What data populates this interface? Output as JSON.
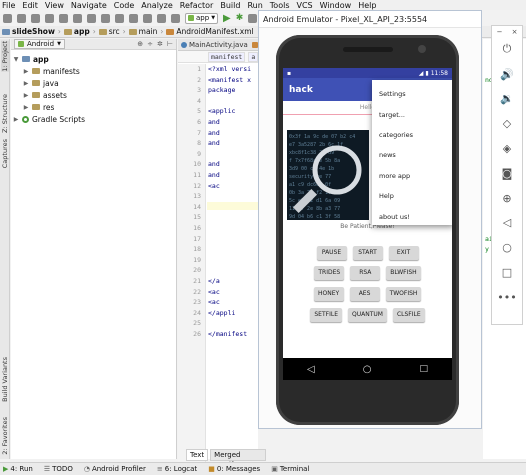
{
  "menubar": [
    "File",
    "Edit",
    "View",
    "Navigate",
    "Code",
    "Analyze",
    "Refactor",
    "Build",
    "Run",
    "Tools",
    "VCS",
    "Window",
    "Help"
  ],
  "toolbar": {
    "run_config": "app"
  },
  "breadcrumbs": [
    "slideShow",
    "app",
    "src",
    "main",
    "AndroidManifest.xml"
  ],
  "left_strip": {
    "project": "1: Project",
    "structure": "Z: Structure",
    "captures": "Captures",
    "build_variants": "Build Variants",
    "favorites": "2: Favorites"
  },
  "project_panel": {
    "view_mode": "Android",
    "tree": [
      {
        "label": "app",
        "depth": 0,
        "icon": "folder-icon",
        "expanded": true
      },
      {
        "label": "manifests",
        "depth": 1,
        "icon": "folder-icon"
      },
      {
        "label": "java",
        "depth": 1,
        "icon": "folder-icon"
      },
      {
        "label": "assets",
        "depth": 1,
        "icon": "folder-icon"
      },
      {
        "label": "res",
        "depth": 1,
        "icon": "folder-icon"
      },
      {
        "label": "Gradle Scripts",
        "depth": 0,
        "icon": "gradle-icon"
      }
    ]
  },
  "editor": {
    "tabs": [
      "MainActivity.java",
      "a"
    ],
    "breadcrumb": [
      "manifest",
      "a"
    ],
    "line_numbers": [
      "1",
      "2",
      "3",
      "4",
      "5",
      "6",
      "7",
      "8",
      "9",
      "10",
      "11",
      "12",
      "13",
      "14",
      "15",
      "16",
      "17",
      "18",
      "19",
      "20",
      "21",
      "22",
      "23",
      "24",
      "25",
      "26"
    ],
    "code_lines": [
      {
        "n": 1,
        "text": "<?xml versi"
      },
      {
        "n": 2,
        "text": "<manifest x"
      },
      {
        "n": 3,
        "text": "    package"
      },
      {
        "n": 5,
        "text": "  <applic"
      },
      {
        "n": 6,
        "text": "      and"
      },
      {
        "n": 7,
        "text": "      and"
      },
      {
        "n": 8,
        "text": "      and"
      },
      {
        "n": 10,
        "text": "      and"
      },
      {
        "n": 11,
        "text": "      and"
      },
      {
        "n": 12,
        "text": "      <ac"
      },
      {
        "n": 21,
        "text": "      </a"
      },
      {
        "n": 22,
        "text": "      <ac"
      },
      {
        "n": 23,
        "text": "      <ac"
      },
      {
        "n": 24,
        "text": "  </appli"
      },
      {
        "n": 26,
        "text": "</manifest"
      }
    ],
    "right_fragments": [
      {
        "line": 2,
        "text": "ndr"
      },
      {
        "line": 17,
        "text": "ain"
      },
      {
        "line": 18,
        "text": "y"
      }
    ]
  },
  "bottom_tabs": [
    "Text",
    "Merged Manifest"
  ],
  "status_bar": [
    "4: Run",
    "TODO",
    "Android Profiler",
    "6: Logcat",
    "0: Messages",
    "Terminal"
  ],
  "emulator": {
    "title": "Android Emulator - Pixel_XL_API_23:5554",
    "status_time": "11:58",
    "app_title": "hack",
    "hello_text": "Hello",
    "wait_text": "Be Patient,Please!",
    "button_rows": [
      [
        "PAUSE",
        "START",
        "EXIT"
      ],
      [
        "TRIDES",
        "RSA",
        "BLWFISH"
      ],
      [
        "HONEY",
        "AES",
        "TWOFISH"
      ],
      [
        "SETFILE",
        "QUANTUM",
        "CLSFILE"
      ]
    ],
    "overflow_menu": [
      "Settings",
      "target...",
      "categories",
      "news",
      "more app",
      "Help",
      "about us!"
    ]
  },
  "emulator_toolbar": {
    "window_controls": [
      "−",
      "×"
    ],
    "icons": [
      "power-icon",
      "volume-up-icon",
      "volume-down-icon",
      "rotate-left-icon",
      "rotate-right-icon",
      "camera-icon",
      "zoom-icon",
      "back-icon",
      "home-icon",
      "overview-icon",
      "more-icon"
    ]
  }
}
